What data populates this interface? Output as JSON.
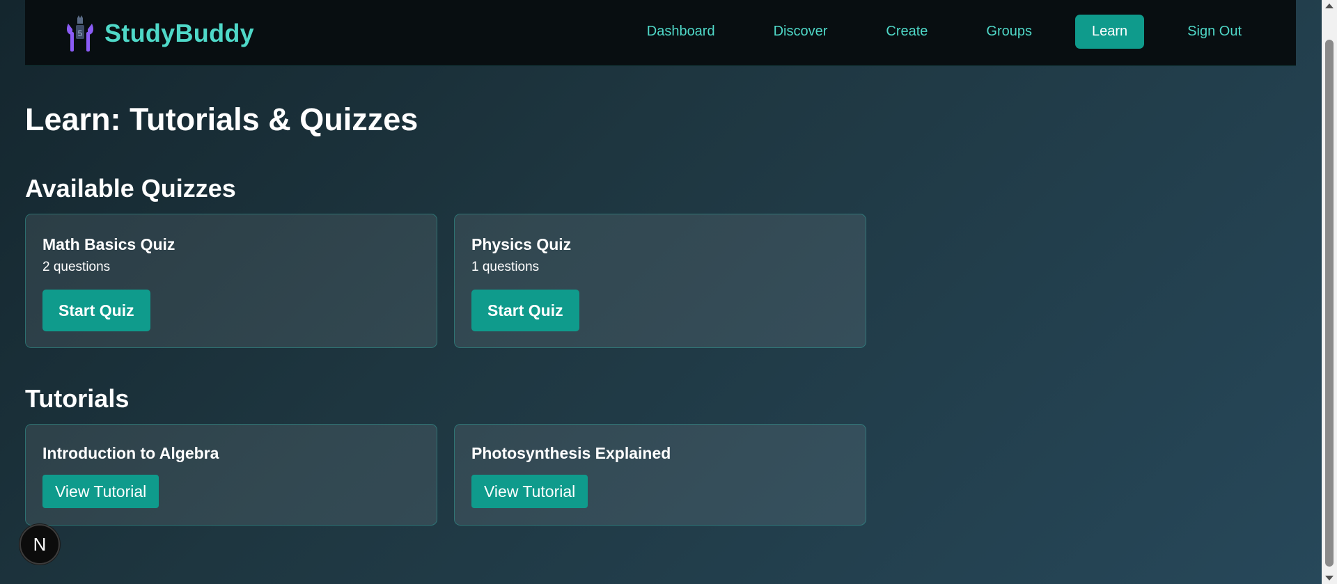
{
  "brand": {
    "name": "StudyBuddy",
    "logo_icon": "study-mascot-icon"
  },
  "nav": {
    "links": [
      {
        "label": "Dashboard",
        "active": false
      },
      {
        "label": "Discover",
        "active": false
      },
      {
        "label": "Create",
        "active": false
      },
      {
        "label": "Groups",
        "active": false
      },
      {
        "label": "Learn",
        "active": true
      },
      {
        "label": "Sign Out",
        "active": false
      }
    ]
  },
  "page": {
    "title": "Learn: Tutorials & Quizzes"
  },
  "quizzes": {
    "title": "Available Quizzes",
    "items": [
      {
        "name": "Math Basics Quiz",
        "count": "2 questions",
        "button": "Start Quiz"
      },
      {
        "name": "Physics Quiz",
        "count": "1 questions",
        "button": "Start Quiz"
      }
    ]
  },
  "tutorials": {
    "title": "Tutorials",
    "items": [
      {
        "name": "Introduction to Algebra",
        "button": "View Tutorial"
      },
      {
        "name": "Photosynthesis Explained",
        "button": "View Tutorial"
      }
    ]
  },
  "dev_badge": {
    "letter": "N",
    "icon": "nextjs-icon"
  },
  "colors": {
    "accent": "#0f9b8c",
    "brand_text": "#4fd8c8",
    "navbar_bg": "#080e11",
    "page_bg": "#1e3640"
  }
}
